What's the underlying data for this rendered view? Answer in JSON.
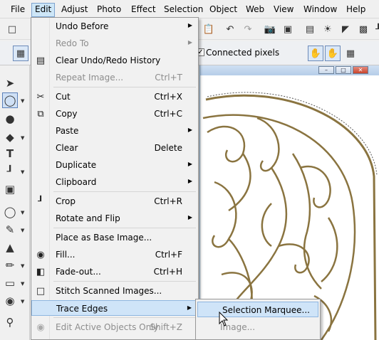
{
  "menubar": {
    "items": [
      "File",
      "Edit",
      "Adjust",
      "Photo",
      "Effect",
      "Selection",
      "Object",
      "Web",
      "View",
      "Window",
      "Help"
    ]
  },
  "toolbar2": {
    "connected_pixels_label": "Connected pixels"
  },
  "edit_menu": {
    "items": [
      {
        "label": "Undo Before",
        "shortcut": "",
        "submenu": true,
        "disabled": false
      },
      {
        "label": "Redo To",
        "shortcut": "",
        "submenu": true,
        "disabled": true
      },
      {
        "label": "Clear Undo/Redo History",
        "shortcut": "",
        "submenu": false,
        "disabled": false
      },
      {
        "label": "Repeat Image...",
        "shortcut": "Ctrl+T",
        "submenu": false,
        "disabled": true
      },
      {
        "label": "Cut",
        "shortcut": "Ctrl+X",
        "submenu": false,
        "disabled": false
      },
      {
        "label": "Copy",
        "shortcut": "Ctrl+C",
        "submenu": false,
        "disabled": false
      },
      {
        "label": "Paste",
        "shortcut": "",
        "submenu": true,
        "disabled": false
      },
      {
        "label": "Clear",
        "shortcut": "Delete",
        "submenu": false,
        "disabled": false
      },
      {
        "label": "Duplicate",
        "shortcut": "",
        "submenu": true,
        "disabled": false
      },
      {
        "label": "Clipboard",
        "shortcut": "",
        "submenu": true,
        "disabled": false
      },
      {
        "label": "Crop",
        "shortcut": "Ctrl+R",
        "submenu": false,
        "disabled": false
      },
      {
        "label": "Rotate and Flip",
        "shortcut": "",
        "submenu": true,
        "disabled": false
      },
      {
        "label": "Place as Base Image...",
        "shortcut": "",
        "submenu": false,
        "disabled": false
      },
      {
        "label": "Fill...",
        "shortcut": "Ctrl+F",
        "submenu": false,
        "disabled": false
      },
      {
        "label": "Fade-out...",
        "shortcut": "Ctrl+H",
        "submenu": false,
        "disabled": false
      },
      {
        "label": "Stitch Scanned Images...",
        "shortcut": "",
        "submenu": false,
        "disabled": false
      },
      {
        "label": "Trace Edges",
        "shortcut": "",
        "submenu": true,
        "disabled": false
      },
      {
        "label": "Edit Active Objects Only",
        "shortcut": "Shift+Z",
        "submenu": false,
        "disabled": true
      }
    ]
  },
  "trace_edges_submenu": {
    "items": [
      {
        "label": "Selection Marquee...",
        "disabled": false
      },
      {
        "label": "Image...",
        "disabled": true
      }
    ]
  },
  "colors": {
    "highlight": "#cfe4f8",
    "highlight_border": "#8eb6e0",
    "ornament": "#8a7440"
  }
}
